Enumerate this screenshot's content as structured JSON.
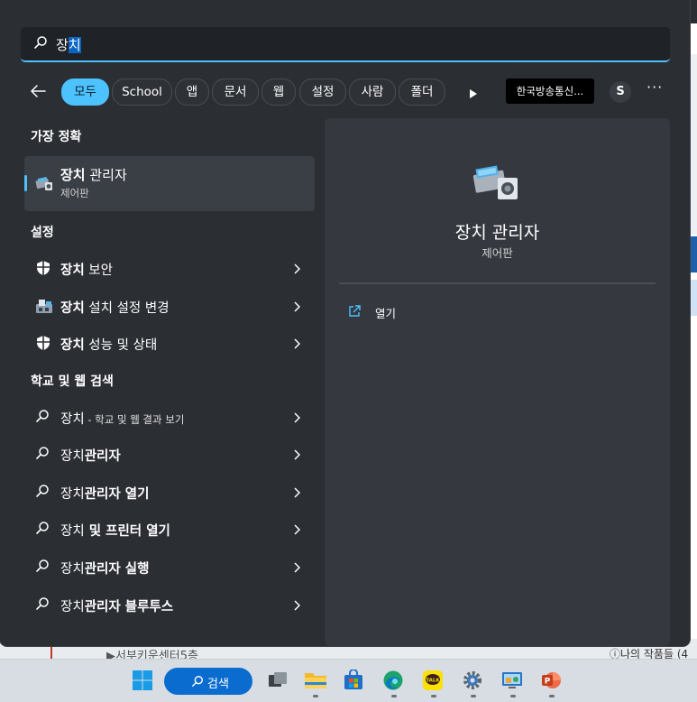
{
  "search": {
    "query_prefix": "장",
    "query_selected": "치"
  },
  "filters": {
    "chips": [
      "모두",
      "School",
      "앱",
      "문서",
      "웹",
      "설정",
      "사람",
      "폴더"
    ],
    "active": "모두",
    "org_label": "한국방송통신...",
    "avatar_letter": "S",
    "more_label": "···"
  },
  "left": {
    "best_heading": "가장 정확",
    "best": {
      "title_bold": "장치",
      "title_rest": " 관리자",
      "subtitle": "제어판"
    },
    "settings_heading": "설정",
    "settings": [
      {
        "bold": "장치",
        "rest": " 보안",
        "icon": "shield-icon"
      },
      {
        "bold": "장치",
        "rest": " 설치 설정 변경",
        "icon": "device-install-icon"
      },
      {
        "bold": "장치",
        "rest": " 성능 및 상태",
        "icon": "shield-icon"
      }
    ],
    "web_heading": "학교 및 웹 검색",
    "web": [
      {
        "plain": "장치",
        "bold": "",
        "small": " - 학교 및 웹 결과 보기"
      },
      {
        "plain": "장치",
        "bold": "관리자",
        "small": ""
      },
      {
        "plain": "장치",
        "bold": "관리자 열기",
        "small": ""
      },
      {
        "plain": "장치",
        "bold": " 및 프린터 열기",
        "small": ""
      },
      {
        "plain": "장치",
        "bold": "관리자 실행",
        "small": ""
      },
      {
        "plain": "장치",
        "bold": "관리자 블루투스",
        "small": ""
      }
    ]
  },
  "preview": {
    "title": "장치 관리자",
    "subtitle": "제어판",
    "action_label": "열기"
  },
  "background": {
    "bottom_left_text": "▶서부키운센터5층",
    "bottom_right_text": "ⓘ나의 작품들 (4"
  },
  "taskbar": {
    "search_label": "검색",
    "accent": "#0a6ccf"
  },
  "colors": {
    "accent": "#4cc2ff",
    "panel_bg": "#2b2e33",
    "preview_bg": "#35393f"
  }
}
